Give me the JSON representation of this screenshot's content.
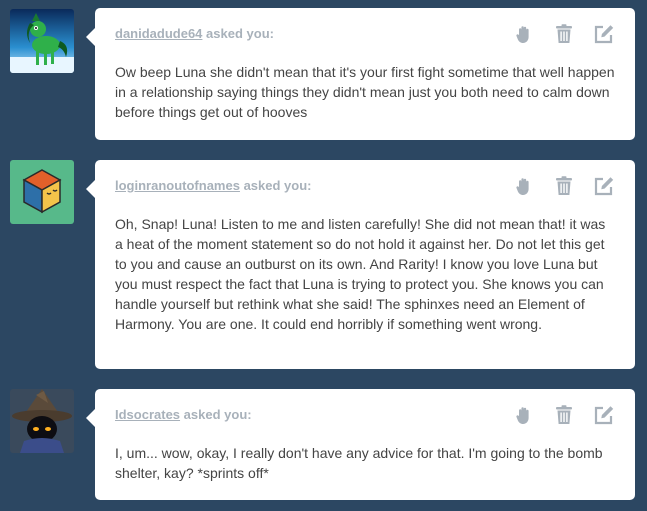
{
  "asks": [
    {
      "asker": "danidadude64",
      "suffix": "asked you:",
      "message": "Ow beep Luna she didn't mean that it's your first fight sometime that well happen in a relationship saying things they didn't mean just you both need to calm down before things get out of hooves"
    },
    {
      "asker": "loginranoutofnames",
      "suffix": "asked you:",
      "message": "Oh, Snap! Luna! Listen to me and listen carefully! She did not mean that! it was a heat of the moment statement so do not hold it against her. Do not let this get to you and cause an outburst on its own. And Rarity! I know you love Luna but you must respect the fact that Luna is trying to protect you. She knows you can handle yourself but rethink what she said! The sphinxes need an Element of Harmony. You are one. It could end horribly if something went wrong."
    },
    {
      "asker": "Idsocrates",
      "suffix": "asked you:",
      "message": "I, um... wow, okay, I really don't have any advice for that. I'm going to the bomb shelter, kay? *sprints off*"
    }
  ],
  "colors": {
    "background": "#2c4762",
    "card": "#ffffff",
    "asker_text": "#a8b1ba",
    "message_text": "#444444",
    "icon": "#a8b1ba"
  },
  "icons": [
    "block-hand-icon",
    "delete-trash-icon",
    "edit-answer-icon"
  ]
}
